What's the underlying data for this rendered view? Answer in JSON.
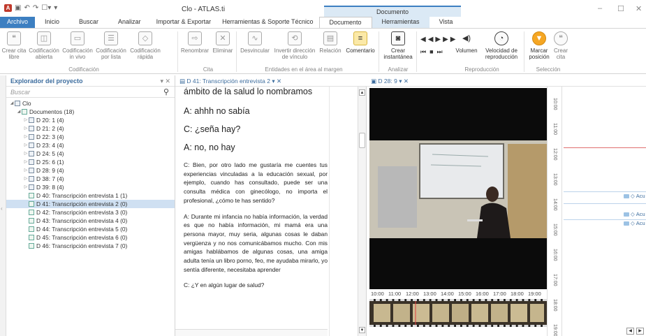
{
  "window": {
    "title": "Clo - ATLAS.ti",
    "context_header": "Documento",
    "min": "–",
    "max": "☐",
    "close": "✕"
  },
  "tabs": [
    "Archivo",
    "Inicio",
    "Buscar",
    "Analizar",
    "Importar & Exportar",
    "Herramientas & Soporte Técnico",
    "Documento",
    "Herramientas",
    "Vista"
  ],
  "ribbon": {
    "buttons": [
      {
        "label": "Crear cita libre",
        "icon": "quote-icon",
        "glyph": "❝"
      },
      {
        "label": "Codificación abierta",
        "icon": "code-open-icon",
        "glyph": "◫"
      },
      {
        "label": "Codificación in vivo",
        "icon": "code-invivo-icon",
        "glyph": "▭"
      },
      {
        "label": "Codificación por lista",
        "icon": "code-list-icon",
        "glyph": "☰"
      },
      {
        "label": "Codificación rápida",
        "icon": "code-quick-icon",
        "glyph": "◇"
      },
      {
        "label": "Renombrar",
        "icon": "rename-icon",
        "glyph": "⇨"
      },
      {
        "label": "Eliminar",
        "icon": "delete-icon",
        "glyph": "✕"
      },
      {
        "label": "Desvincular",
        "icon": "unlink-icon",
        "glyph": "∿"
      },
      {
        "label": "Invertir dirección de vínculo",
        "icon": "invert-link-icon",
        "glyph": "⟲"
      },
      {
        "label": "Relación",
        "icon": "relation-icon",
        "glyph": "▤"
      },
      {
        "label": "Comentario",
        "icon": "comment-icon",
        "glyph": "≡"
      },
      {
        "label": "Crear instantánea",
        "icon": "camera-icon",
        "glyph": "◙"
      },
      {
        "label": "Volumen",
        "icon": "volume-icon",
        "glyph": "◀)"
      },
      {
        "label": "Velocidad de reproducción",
        "icon": "speed-icon",
        "glyph": "◔"
      },
      {
        "label": "Marcar posición",
        "icon": "mark-icon",
        "glyph": "▼"
      },
      {
        "label": "Crear cita",
        "icon": "create-quote-icon",
        "glyph": "❝"
      }
    ],
    "groups": [
      "Codificación",
      "Cita",
      "Entidades en el área al margen",
      "Analizar",
      "Reproducción",
      "Selección"
    ]
  },
  "explorer": {
    "title": "Explorador del proyecto",
    "controls": "▾ ✕",
    "search_placeholder": "Buscar",
    "project": "Clo",
    "documents_label": "Documentos (18)",
    "items": [
      "D 20: 1 (4)",
      "D 21: 2 (4)",
      "D 22: 3 (4)",
      "D 23: 4 (4)",
      "D 24: 5 (4)",
      "D 25: 6 (1)",
      "D 28: 9 (4)",
      "D 38: 7 (4)",
      "D 39: 8 (4)",
      "D 40: Transcripción entrevista 1 (1)",
      "D 41: Transcripción entrevista 2 (0)",
      "D 42: Transcripción entrevista 3 (0)",
      "D 43: Transcripción entrevista 4 (0)",
      "D 44: Transcripción entrevista 5 (0)",
      "D 45: Transcripción entrevista 6 (0)",
      "D 46: Transcripción entrevista 7 (0)"
    ]
  },
  "document": {
    "tab": "D 41: Transcripción entrevista 2",
    "lines": [
      "ámbito de la salud lo nombramos",
      "A: ahhh no sabía",
      "C: ¿seña hay?",
      "A: no, no hay",
      "C: Bien, por otro lado me gustaría me cuentes tus experiencias vinculadas a la educación sexual, por ejemplo, cuando has consultado, puede ser una consulta médica con ginecólogo, no importa el profesional, ¿cómo te has sentido?",
      "A: Durante mi infancia no había información, la verdad es que no había información, mi mamá era una persona mayor, muy seria, algunas cosas le daban vergüenza y no nos comunicábamos mucho. Con mis amigas hablábamos de algunas cosas, una amiga adulta tenía un libro porno, feo, me ayudaba mirarlo, yo sentía diferente, necesitaba aprender",
      "C: ¿Y en algún lugar de salud?"
    ]
  },
  "video": {
    "tab": "D 28: 9",
    "controls": [
      "◀◀",
      "▶",
      "▶▶",
      "⏮",
      "■",
      "⏭"
    ],
    "timeline_ticks": [
      "10:00",
      "11:00",
      "12:00",
      "13:00",
      "14:00",
      "15:00",
      "16:00",
      "17:00",
      "18:00",
      "19:00"
    ],
    "ruler_ticks": [
      "10:00",
      "11:00",
      "12:00",
      "13:00",
      "14:00",
      "15:00",
      "16:00",
      "17:00",
      "18:00",
      "19:00"
    ],
    "quotes": [
      "Acu",
      "Acu",
      "Acu"
    ]
  },
  "colors": {
    "accent": "#3d7fc1",
    "context": "#dbe9f5",
    "selected": "#cfe0f2"
  }
}
